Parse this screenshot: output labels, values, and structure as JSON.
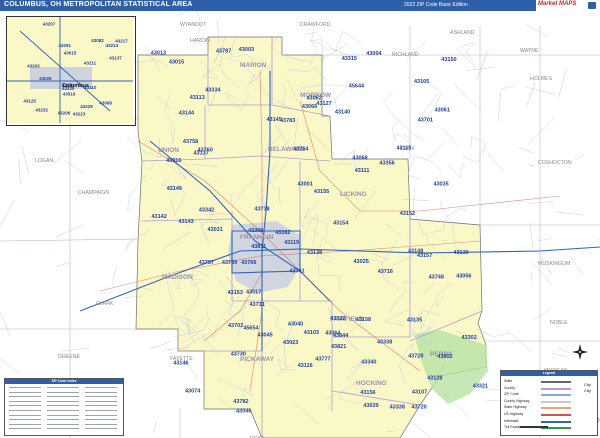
{
  "header": {
    "title": "COLUMBUS, OH METROPOLITAN STATISTICAL AREA",
    "edition": "2022 ZIP Code Basic Edition",
    "brand": "Market MAPS"
  },
  "colors": {
    "header": "#2f5fa8",
    "msa_fill": "#fbf8c8",
    "outside_fill": "#ffffff",
    "county_line": "#b49ad4",
    "zip_label": "#1f3ea5",
    "city_fill": "#c9cfe0",
    "forest_fill": "#b8e2a4",
    "interstate": "#2f64b9",
    "us_highway": "#d2524a",
    "state_highway": "#b9b9b9"
  },
  "inset": {
    "city": "Columbus",
    "zip_codes": [
      "43203",
      "43207",
      "43015",
      "43082",
      "43019",
      "43217",
      "43291",
      "43213",
      "43206",
      "43223",
      "43068",
      "43232",
      "43227",
      "43229",
      "43211",
      "43220",
      "43110",
      "43125",
      "43137",
      "43026"
    ]
  },
  "counties_outside": [
    "WYANDOT",
    "RICHLAND",
    "WAYNE",
    "HOLMES",
    "HARDIN",
    "COSHOCTON",
    "CHAMPAIGN",
    "LOGAN",
    "MUSKINGUM",
    "CLARK",
    "NOBLE",
    "GREENE",
    "MORGAN",
    "ROSS",
    "ATHENS",
    "WASHINGTON",
    "CRAWFORD",
    "ASHLAND",
    "KNOX",
    "FAYETTE"
  ],
  "counties_msa": [
    "MARION",
    "MORROW",
    "UNION",
    "DELAWARE",
    "LICKING",
    "MADISON",
    "FRANKLIN",
    "FAIRFIELD",
    "PICKAWAY",
    "HOCKING",
    "PERRY"
  ],
  "zip_codes": [
    "43802",
    "43302",
    "43322",
    "43315",
    "43338",
    "43356",
    "43338",
    "43321",
    "43334",
    "43340",
    "43342",
    "43306",
    "43004",
    "43064",
    "43040",
    "43074",
    "43066",
    "43061",
    "43045",
    "43003",
    "43029",
    "43017",
    "43015",
    "43023",
    "43035",
    "43062",
    "43056",
    "43811",
    "43821",
    "43844",
    "43068",
    "43025",
    "43031",
    "43013",
    "43001",
    "43046",
    "43016",
    "43162",
    "43140",
    "43143",
    "43115",
    "43119",
    "43116",
    "43150",
    "43137",
    "43103",
    "43113",
    "43146",
    "43138",
    "43107",
    "43154",
    "43157",
    "43153",
    "43130",
    "43105",
    "43135",
    "43155",
    "43148",
    "43152",
    "43111",
    "43144",
    "43127",
    "43158",
    "43149",
    "43145",
    "43128",
    "43142",
    "43156",
    "45644",
    "45654",
    "43716",
    "43730",
    "43739",
    "43748",
    "43758",
    "43760",
    "43764",
    "43777",
    "43783",
    "43720",
    "43728",
    "43731",
    "43782",
    "43766",
    "43787",
    "43757",
    "43738",
    "43761",
    "43701",
    "43702"
  ],
  "index_panel": {
    "title": "ZIP Code Index",
    "rows": 30
  },
  "legend": {
    "title": "Legend",
    "items": [
      {
        "label": "State",
        "color": "#666666"
      },
      {
        "label": "County",
        "color": "#b49ad4"
      },
      {
        "label": "ZIP Code",
        "color": "#8aa7d6"
      },
      {
        "label": "County Highway",
        "color": "#c9c9c9"
      },
      {
        "label": "State Highway",
        "color": "#e9a56b"
      },
      {
        "label": "US Highway",
        "color": "#d2524a"
      },
      {
        "label": "Interstate",
        "color": "#2f64b9"
      },
      {
        "label": "Toll Roads",
        "color": "#2d9c44"
      }
    ],
    "city_label": "City",
    "city_label2": "City"
  }
}
